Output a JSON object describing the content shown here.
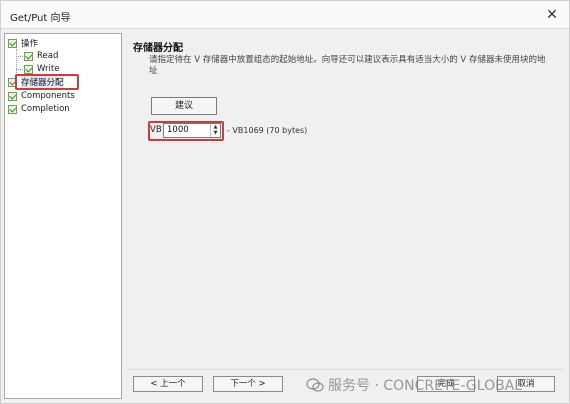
{
  "window": {
    "title": "Get/Put 向导",
    "close_glyph": "✕"
  },
  "nav": {
    "items": [
      {
        "label": "操作",
        "checked": true,
        "level": 0
      },
      {
        "label": "Read",
        "checked": true,
        "level": 1
      },
      {
        "label": "Write",
        "checked": true,
        "level": 1
      },
      {
        "label": "存储器分配",
        "checked": true,
        "level": 0,
        "selected": true
      },
      {
        "label": "Components",
        "checked": true,
        "level": 0
      },
      {
        "label": "Completion",
        "checked": true,
        "level": 0
      }
    ]
  },
  "content": {
    "section_title": "存储器分配",
    "description": "请指定待在 V 存储器中放置组态的起始地址。向导还可以建议表示具有适当大小的 V 存储器未使用块的地址",
    "suggest_label": "建议",
    "address_prefix": "VB",
    "address_value": "1000",
    "range_text": "- VB1069 (70 bytes)"
  },
  "buttons": {
    "prev": "< 上一个",
    "next": "下一个 >",
    "finish": "完成",
    "cancel": "取消"
  },
  "watermark": {
    "text": "服务号 · CONCRETE-GLOBAL"
  },
  "colors": {
    "highlight_red": "#d23a3a",
    "check_green": "#2e8b1f"
  }
}
